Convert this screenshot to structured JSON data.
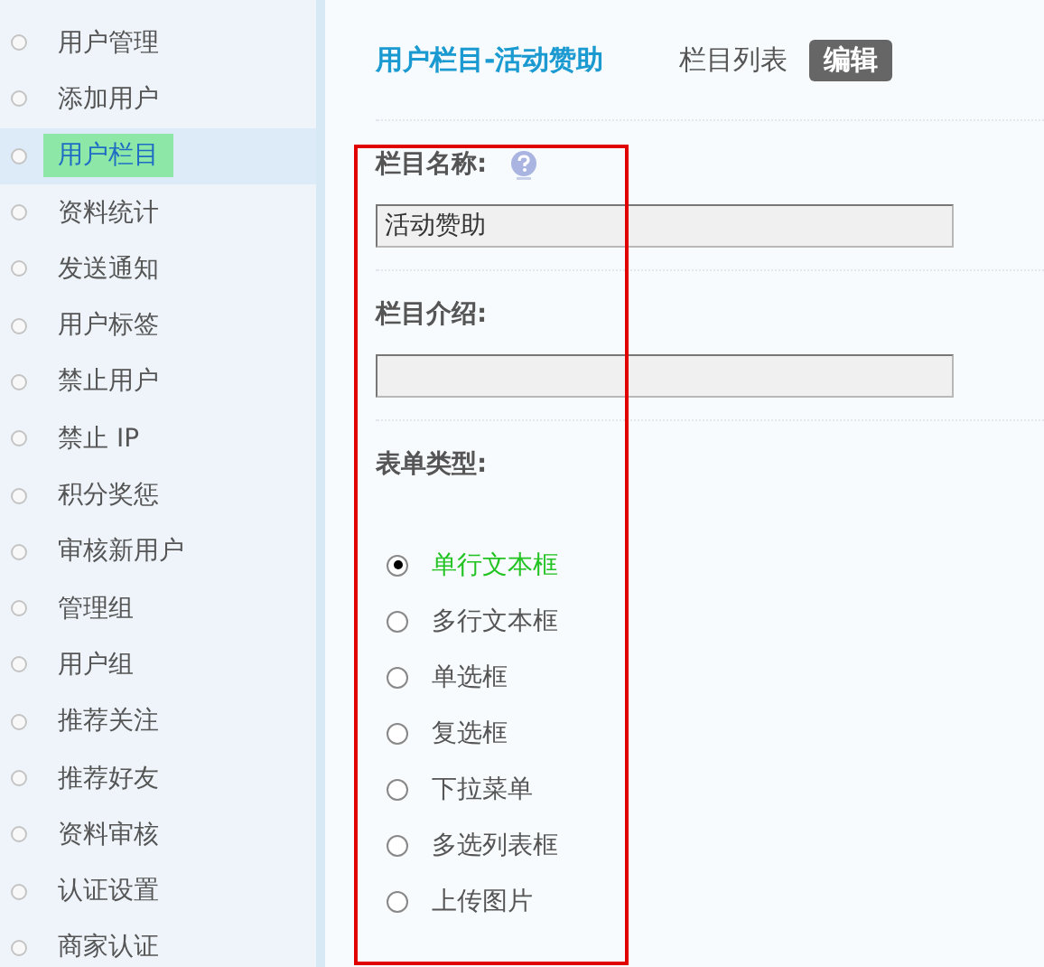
{
  "sidebar": {
    "items": [
      {
        "label": "用户管理",
        "selected": false
      },
      {
        "label": "添加用户",
        "selected": false
      },
      {
        "label": "用户栏目",
        "selected": true
      },
      {
        "label": "资料统计",
        "selected": false
      },
      {
        "label": "发送通知",
        "selected": false
      },
      {
        "label": "用户标签",
        "selected": false
      },
      {
        "label": "禁止用户",
        "selected": false
      },
      {
        "label": "禁止 IP",
        "selected": false
      },
      {
        "label": "积分奖惩",
        "selected": false
      },
      {
        "label": "审核新用户",
        "selected": false
      },
      {
        "label": "管理组",
        "selected": false
      },
      {
        "label": "用户组",
        "selected": false
      },
      {
        "label": "推荐关注",
        "selected": false
      },
      {
        "label": "推荐好友",
        "selected": false
      },
      {
        "label": "资料审核",
        "selected": false
      },
      {
        "label": "认证设置",
        "selected": false
      },
      {
        "label": "商家认证",
        "selected": false
      }
    ]
  },
  "header": {
    "title": "用户栏目-活动赞助",
    "tabs": [
      {
        "label": "栏目列表",
        "selected": false
      },
      {
        "label": "编辑",
        "selected": true
      }
    ]
  },
  "form": {
    "name_label": "栏目名称:",
    "name_value": "活动赞助",
    "intro_label": "栏目介绍:",
    "type_label": "表单类型:",
    "types": [
      {
        "label": "单行文本框",
        "selected": true
      },
      {
        "label": "多行文本框",
        "selected": false
      },
      {
        "label": "单选框",
        "selected": false
      },
      {
        "label": "复选框",
        "selected": false
      },
      {
        "label": "下拉菜单",
        "selected": false
      },
      {
        "label": "多选列表框",
        "selected": false
      },
      {
        "label": "上传图片",
        "selected": false
      }
    ]
  }
}
